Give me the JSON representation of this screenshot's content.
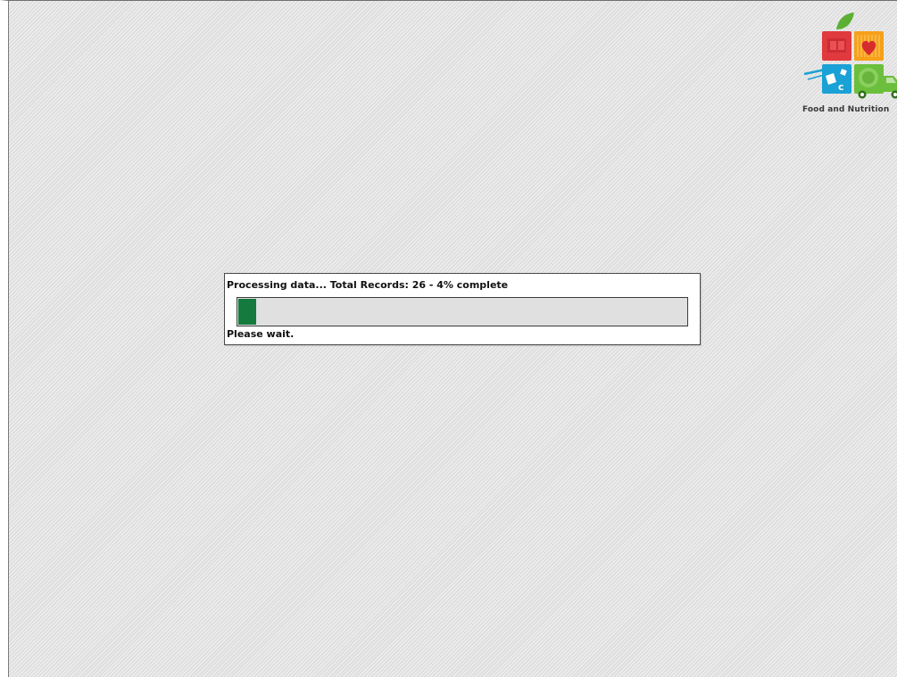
{
  "logo": {
    "text": "Food and Nutrition",
    "icon": "food-and-nutrition-logo",
    "colors": {
      "red": "#e03a3e",
      "orange": "#f6a01a",
      "blue": "#1aa1d6",
      "green": "#6cbf3c"
    }
  },
  "progress": {
    "status_text": "Processing data... Total Records: 26 - 4% complete",
    "wait_text": "Please wait.",
    "percent": 4,
    "fill_color": "#157a3e"
  }
}
